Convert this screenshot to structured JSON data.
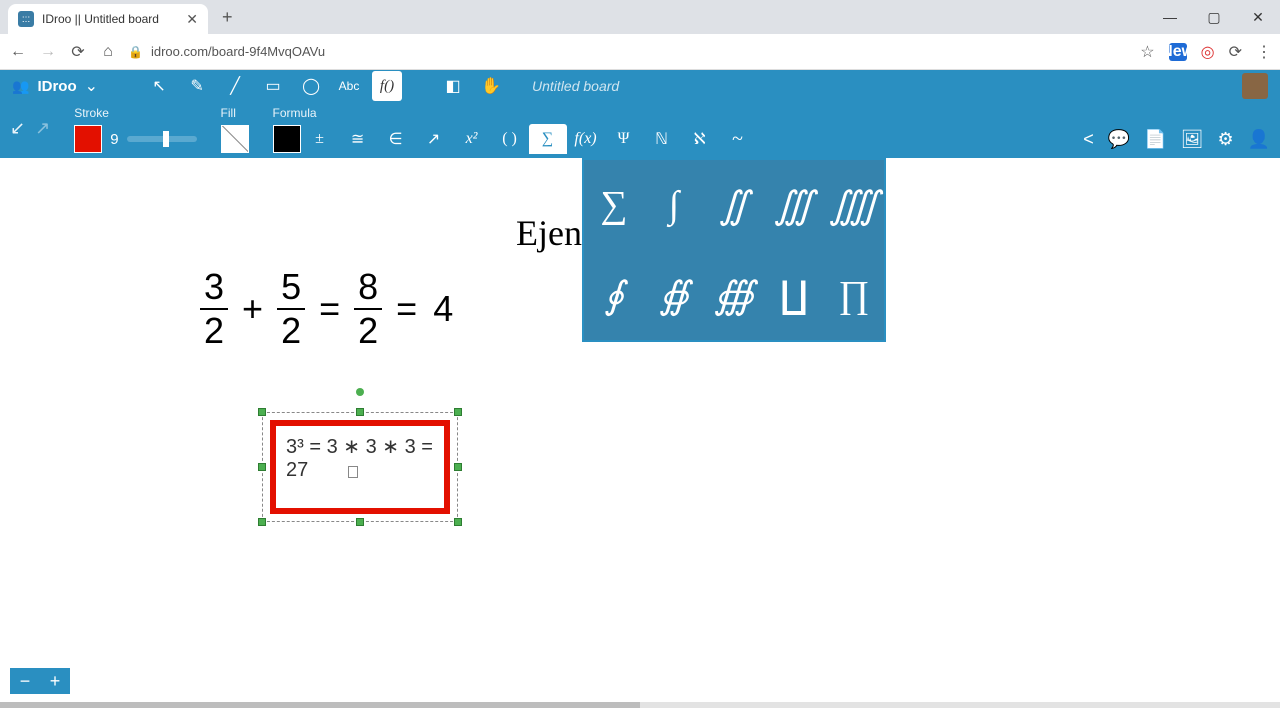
{
  "browser": {
    "tab_title": "IDroo || Untitled board",
    "url": "idroo.com/board-9f4MvqOAVu",
    "new_tab": "+",
    "win_min": "—",
    "win_max": "▢",
    "win_close": "✕",
    "back": "←",
    "forward": "→",
    "reload": "⟳",
    "home": "⌂",
    "star": "☆",
    "ext_new": "New",
    "menu": "⋮"
  },
  "app": {
    "logo": "IDroo",
    "caret": "⌄",
    "board_title": "Untitled board",
    "tools": {
      "select": "↖",
      "pen": "✎",
      "line": "╱",
      "rect": "▭",
      "ellipse": "◯",
      "text": "Abc",
      "formula": "f()",
      "eraser": "◧",
      "pan": "✋"
    }
  },
  "subbar": {
    "stroke_label": "Stroke",
    "fill_label": "Fill",
    "formula_label": "Formula",
    "stroke_value": "9",
    "collapse": "↙",
    "expand": "↗",
    "f": {
      "pm": "±",
      "cong": "≅",
      "in": "∈",
      "arrow": "↗",
      "sq": "x²",
      "paren": "( )",
      "sigma": "∑",
      "fx": "f(x)",
      "psi": "Ψ",
      "nat": "ℕ",
      "aleph": "ℵ",
      "tilde": "~"
    },
    "right": {
      "share": "↗",
      "chat": "▤",
      "doc": "▦",
      "image": "▣",
      "settings": "⚙",
      "user": "👤"
    }
  },
  "canvas": {
    "ejem": "Ejen",
    "frac1n": "3",
    "frac1d": "2",
    "plus": "+",
    "frac2n": "5",
    "frac2d": "2",
    "eq": "=",
    "frac3n": "8",
    "frac3d": "2",
    "eq2": "=",
    "res": "4",
    "box_text": "3³ = 3 ∗ 3 ∗ 3 = 27"
  },
  "panel": {
    "sigma": "∑",
    "int": "∫",
    "iint": "∬",
    "iiint": "∭",
    "iiiint": "⨌",
    "oint": "∮",
    "oiint": "∯",
    "oiiint": "∰",
    "coprod": "∐",
    "prod": "∏"
  },
  "zoom": {
    "minus": "−",
    "plus": "+"
  }
}
